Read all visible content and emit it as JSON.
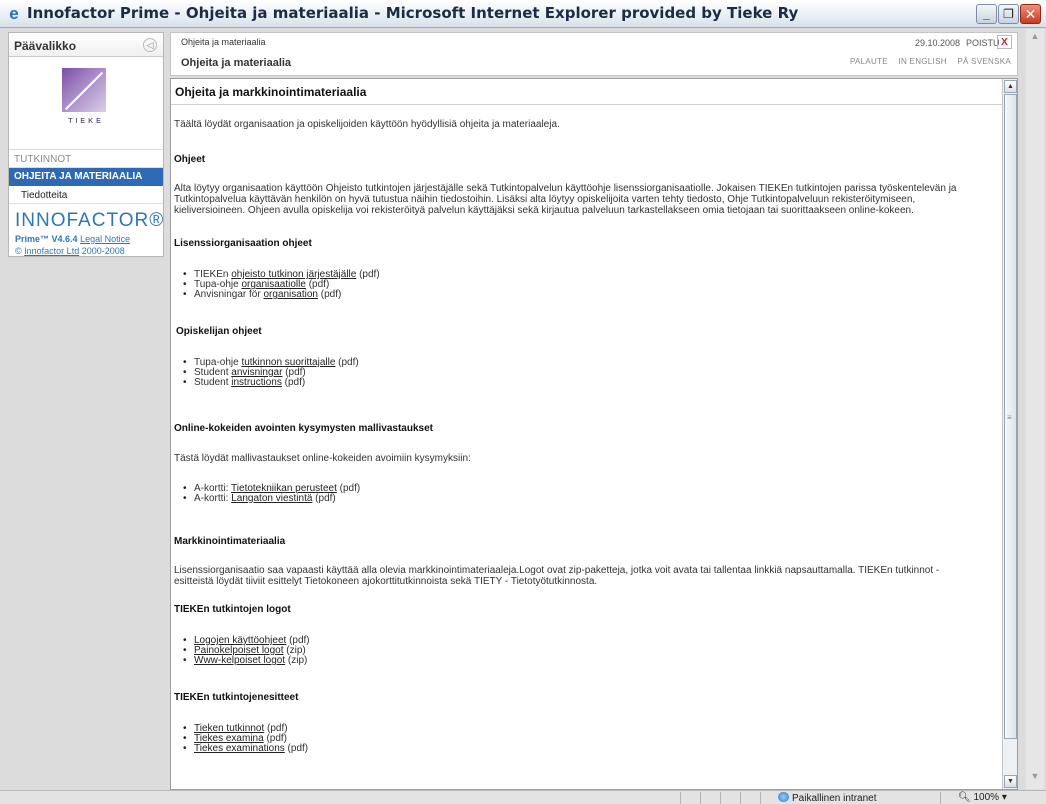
{
  "window": {
    "title": "Innofactor Prime - Ohjeita ja materiaalia - Microsoft Internet Explorer provided by Tieke Ry",
    "min_label": "_",
    "max_label": "❐",
    "close_label": "✕"
  },
  "sidebar": {
    "header": "Päävalikko",
    "logo_text": "TIEKE",
    "section": "TUTKINNOT",
    "active_item": "OHJEITA JA MATERIAALIA",
    "item": "Tiedotteita",
    "brand": "INNOFACTOR®",
    "version": "Prime™ V4.6.4",
    "legal": "Legal Notice",
    "copyright_pre": "©",
    "copyright_link": "Innofactor Ltd",
    "copyright_years": "2000-2008"
  },
  "header": {
    "breadcrumb": "Ohjeita ja materiaalia",
    "page_title": "Ohjeita ja materiaalia",
    "date": "29.10.2008",
    "logout": "POISTU",
    "close_x": "X",
    "link_feedback": "PALAUTE",
    "link_english": "IN ENGLISH",
    "link_swedish": "PÅ SVENSKA"
  },
  "content": {
    "heading": "Ohjeita ja markkinointimateriaalia",
    "intro": "Täältä löydät organisaation ja opiskelijoiden käyttöön hyödyllisiä ohjeita ja materiaaleja.",
    "s1_title": "Ohjeet",
    "s1_p1": "Alta löytyy organisaation käyttöön Ohjeisto tutkintojen järjestäjälle sekä Tutkintopalvelun käyttöohje lisenssiorganisaatiolle. Jokaisen TIEKEn tutkintojen parissa työskentelevän ja",
    "s1_p2": "Tutkintopalvelua käyttävän henkilön on hyvä tutustua näihin tiedostoihin. Lisäksi alta löytyy opiskelijoita varten tehty tiedosto, Ohje Tutkintopalveluun rekisteröitymiseen,",
    "s1_p3": "kieliversioineen. Ohjeen avulla opiskelija voi rekisteröityä palvelun käyttäjäksi sekä kirjautua palveluun tarkastellakseen omia tietojaan tai suorittaakseen online-kokeen.",
    "s2_title": "Lisenssiorganisaation ohjeet",
    "s2_items": [
      {
        "pre": "TIEKEn ",
        "link": "ohjeisto tutkinon järjestäjälle",
        "post": " (pdf)"
      },
      {
        "pre": "Tupa-ohje ",
        "link": "organisaatiolle",
        "post": " (pdf)"
      },
      {
        "pre": "Anvisningar för ",
        "link": "organisation",
        "post": " (pdf)"
      }
    ],
    "s3_title": "Opiskelijan ohjeet",
    "s3_items": [
      {
        "pre": "Tupa-ohje ",
        "link": "tutkinnon suorittajalle",
        "post": " (pdf)"
      },
      {
        "pre": "Student ",
        "link": "anvisningar",
        "post": " (pdf)"
      },
      {
        "pre": "Student ",
        "link": "instructions",
        "post": " (pdf)"
      }
    ],
    "s4_title": "Online-kokeiden avointen kysymysten mallivastaukset",
    "s4_p": "Tästä löydät mallivastaukset online-kokeiden avoimiin kysymyksiin:",
    "s4_items": [
      {
        "pre": "A-kortti: ",
        "link": "Tietotekniikan perusteet",
        "post": " (pdf)"
      },
      {
        "pre": "A-kortti: ",
        "link": "Langaton viestintä",
        "post": " (pdf)"
      }
    ],
    "s5_title": "Markkinointimateriaalia",
    "s5_p1": "Lisenssiorganisaatio saa vapaasti käyttää alla olevia markkinointimateriaaleja.Logot ovat zip-paketteja, jotka voit avata tai tallentaa linkkiä napsauttamalla. TIEKEn tutkinnot -",
    "s5_p2": "esitteistä löydät tiiviit esittelyt Tietokoneen ajokorttitutkinnoista sekä TIETY - Tietotyötutkinnosta.",
    "s6_title": "TIEKEn tutkintojen logot",
    "s6_items": [
      {
        "pre": "",
        "link": "Logojen käyttöohjeet",
        "post": " (pdf)"
      },
      {
        "pre": "",
        "link": "Painokelpoiset logot",
        "post": " (zip)"
      },
      {
        "pre": "",
        "link": "Www-kelpoiset logot",
        "post": " (zip)"
      }
    ],
    "s7_title": "TIEKEn tutkintojenesitteet",
    "s7_items": [
      {
        "pre": "",
        "link": "Tieken tutkinnot",
        "post": " (pdf)"
      },
      {
        "pre": "",
        "link": "Tiekes examina",
        "post": " (pdf)"
      },
      {
        "pre": "",
        "link": "Tiekes examinations",
        "post": " (pdf)"
      }
    ]
  },
  "statusbar": {
    "zone": "Paikallinen intranet",
    "zoom": "100%"
  },
  "colors": {
    "accent": "#2d69b5",
    "brand": "#2f76b5",
    "close_red": "#c0262b"
  }
}
